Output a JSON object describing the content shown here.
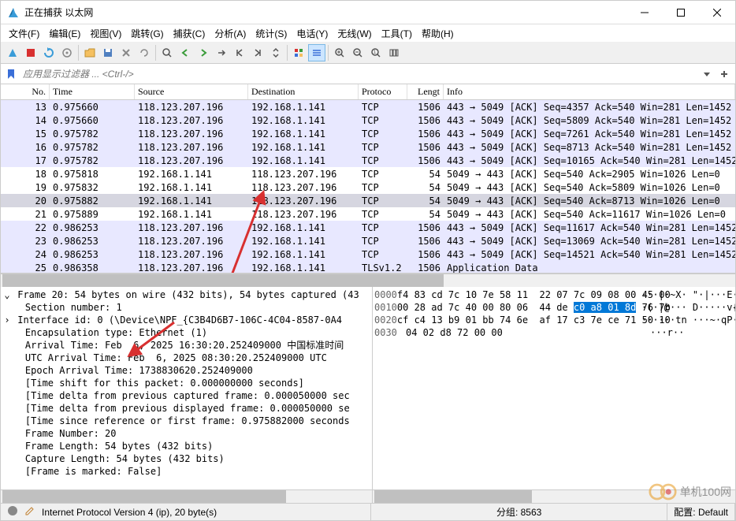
{
  "window": {
    "title": "正在捕获 以太网"
  },
  "menu": [
    "文件(F)",
    "编辑(E)",
    "视图(V)",
    "跳转(G)",
    "捕获(C)",
    "分析(A)",
    "统计(S)",
    "电话(Y)",
    "无线(W)",
    "工具(T)",
    "帮助(H)"
  ],
  "filter": {
    "placeholder": "应用显示过滤器 ... <Ctrl-/>"
  },
  "columns": {
    "no": "No.",
    "time": "Time",
    "src": "Source",
    "dst": "Destination",
    "proto": "Protoco",
    "len": "Lengt",
    "info": "Info"
  },
  "packets": [
    {
      "no": "13",
      "time": "0.975660",
      "src": "118.123.207.196",
      "dst": "192.168.1.141",
      "proto": "TCP",
      "len": "1506",
      "info": "443 → 5049 [ACK] Seq=4357 Ack=540 Win=281 Len=1452",
      "bg": "lav"
    },
    {
      "no": "14",
      "time": "0.975660",
      "src": "118.123.207.196",
      "dst": "192.168.1.141",
      "proto": "TCP",
      "len": "1506",
      "info": "443 → 5049 [ACK] Seq=5809 Ack=540 Win=281 Len=1452",
      "bg": "lav"
    },
    {
      "no": "15",
      "time": "0.975782",
      "src": "118.123.207.196",
      "dst": "192.168.1.141",
      "proto": "TCP",
      "len": "1506",
      "info": "443 → 5049 [ACK] Seq=7261 Ack=540 Win=281 Len=1452",
      "bg": "lav"
    },
    {
      "no": "16",
      "time": "0.975782",
      "src": "118.123.207.196",
      "dst": "192.168.1.141",
      "proto": "TCP",
      "len": "1506",
      "info": "443 → 5049 [ACK] Seq=8713 Ack=540 Win=281 Len=1452",
      "bg": "lav"
    },
    {
      "no": "17",
      "time": "0.975782",
      "src": "118.123.207.196",
      "dst": "192.168.1.141",
      "proto": "TCP",
      "len": "1506",
      "info": "443 → 5049 [ACK] Seq=10165 Ack=540 Win=281 Len=1452",
      "bg": "lav"
    },
    {
      "no": "18",
      "time": "0.975818",
      "src": "192.168.1.141",
      "dst": "118.123.207.196",
      "proto": "TCP",
      "len": "54",
      "info": "5049 → 443 [ACK] Seq=540 Ack=2905 Win=1026 Len=0",
      "bg": "white"
    },
    {
      "no": "19",
      "time": "0.975832",
      "src": "192.168.1.141",
      "dst": "118.123.207.196",
      "proto": "TCP",
      "len": "54",
      "info": "5049 → 443 [ACK] Seq=540 Ack=5809 Win=1026 Len=0",
      "bg": "white"
    },
    {
      "no": "20",
      "time": "0.975882",
      "src": "192.168.1.141",
      "dst": "118.123.207.196",
      "proto": "TCP",
      "len": "54",
      "info": "5049 → 443 [ACK] Seq=540 Ack=8713 Win=1026 Len=0",
      "bg": "sel",
      "sel": true
    },
    {
      "no": "21",
      "time": "0.975889",
      "src": "192.168.1.141",
      "dst": "118.123.207.196",
      "proto": "TCP",
      "len": "54",
      "info": "5049 → 443 [ACK] Seq=540 Ack=11617 Win=1026 Len=0",
      "bg": "white"
    },
    {
      "no": "22",
      "time": "0.986253",
      "src": "118.123.207.196",
      "dst": "192.168.1.141",
      "proto": "TCP",
      "len": "1506",
      "info": "443 → 5049 [ACK] Seq=11617 Ack=540 Win=281 Len=1452",
      "bg": "lav"
    },
    {
      "no": "23",
      "time": "0.986253",
      "src": "118.123.207.196",
      "dst": "192.168.1.141",
      "proto": "TCP",
      "len": "1506",
      "info": "443 → 5049 [ACK] Seq=13069 Ack=540 Win=281 Len=1452",
      "bg": "lav"
    },
    {
      "no": "24",
      "time": "0.986253",
      "src": "118.123.207.196",
      "dst": "192.168.1.141",
      "proto": "TCP",
      "len": "1506",
      "info": "443 → 5049 [ACK] Seq=14521 Ack=540 Win=281 Len=1452",
      "bg": "lav"
    },
    {
      "no": "25",
      "time": "0.986358",
      "src": "118.123.207.196",
      "dst": "192.168.1.141",
      "proto": "TLSv1.2",
      "len": "1506",
      "info": "Application Data",
      "bg": "lav"
    }
  ],
  "details": [
    {
      "exp": "v",
      "txt": "Frame 20: 54 bytes on wire (432 bits), 54 bytes captured (43"
    },
    {
      "ind": 2,
      "txt": "Section number: 1"
    },
    {
      "exp": ">",
      "ind": 1,
      "txt": "Interface id: 0 (\\Device\\NPF_{C3B4D6B7-106C-4C04-8587-0A4"
    },
    {
      "ind": 2,
      "txt": "Encapsulation type: Ethernet (1)"
    },
    {
      "ind": 2,
      "txt": "Arrival Time: Feb  6, 2025 16:30:20.252409000 中国标准时间"
    },
    {
      "ind": 2,
      "txt": "UTC Arrival Time: Feb  6, 2025 08:30:20.252409000 UTC"
    },
    {
      "ind": 2,
      "txt": "Epoch Arrival Time: 1738830620.252409000"
    },
    {
      "ind": 2,
      "txt": "[Time shift for this packet: 0.000000000 seconds]"
    },
    {
      "ind": 2,
      "txt": "[Time delta from previous captured frame: 0.000050000 sec"
    },
    {
      "ind": 2,
      "txt": "[Time delta from previous displayed frame: 0.000050000 se"
    },
    {
      "ind": 2,
      "txt": "[Time since reference or first frame: 0.975882000 seconds"
    },
    {
      "ind": 2,
      "txt": "Frame Number: 20"
    },
    {
      "ind": 2,
      "txt": "Frame Length: 54 bytes (432 bits)"
    },
    {
      "ind": 2,
      "txt": "Capture Length: 54 bytes (432 bits)"
    },
    {
      "ind": 2,
      "txt": "[Frame is marked: False]"
    }
  ],
  "hex": [
    {
      "off": "0000",
      "b1": "f4 83 cd 7c 10 7e 58 11  22 07 7c 09 08 00 45 00",
      "a": "···|·~X· \"·|···E·"
    },
    {
      "off": "0010",
      "b1": "00 28 ad 7c 40 00 80 06  44 de ",
      "bsel": "c0 a8 01 8d",
      "b2": " 76 7b",
      "a": "·(·|@··· D·····v{"
    },
    {
      "off": "0020",
      "b1": "cf c4 13 b9 01 bb 74 6e  af 17 c3 7e ce 71 50 10",
      "a": "······tn ···~·qP·"
    },
    {
      "off": "0030",
      "b1": "04 02 d8 72 00 00",
      "a": "···r··"
    }
  ],
  "status": {
    "left": "Internet Protocol Version 4 (ip), 20 byte(s)",
    "mid": "分组: 8563",
    "right": "配置: Default"
  },
  "watermark": "单机100网"
}
